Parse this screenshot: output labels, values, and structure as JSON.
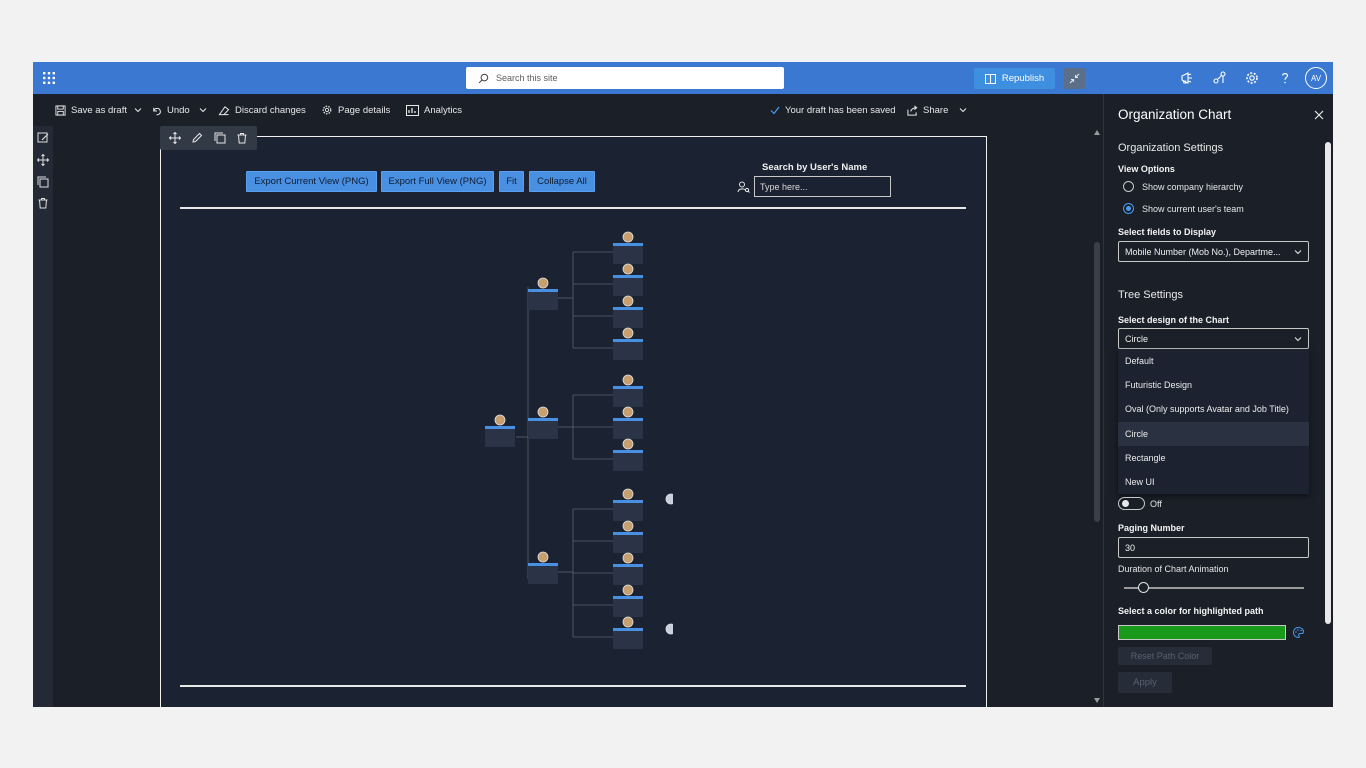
{
  "suitebar": {
    "search_placeholder": "Search this site",
    "avatar_initials": "AV",
    "color": "#3a78d2"
  },
  "command_bar": {
    "save_draft": "Save as draft",
    "undo": "Undo",
    "discard": "Discard changes",
    "page_details": "Page details",
    "analytics": "Analytics",
    "draft_status": "Your draft has been saved",
    "share": "Share",
    "republish": "Republish"
  },
  "webpart": {
    "buttons": [
      "Export Current View (PNG)",
      "Export Full View (PNG)",
      "Fit",
      "Collapse All"
    ],
    "search_label": "Search by User's Name",
    "search_placeholder": "Type here..."
  },
  "panel": {
    "title": "Organization Chart",
    "org_settings_heading": "Organization Settings",
    "view_options_label": "View Options",
    "view_options": [
      {
        "label": "Show company hierarchy",
        "selected": false
      },
      {
        "label": "Show current user's team",
        "selected": true
      }
    ],
    "fields_label": "Select fields to Display",
    "fields_value": "Mobile Number (Mob No.), Departme...",
    "tree_settings_heading": "Tree Settings",
    "design_label": "Select design of the Chart",
    "design_value": "Circle",
    "design_options": [
      "Default",
      "Futuristic Design",
      "Oval (Only supports Avatar and Job Title)",
      "Circle",
      "Rectangle",
      "New UI"
    ],
    "design_selected": "Circle",
    "toggle_state": "Off",
    "paging_label": "Paging Number",
    "paging_value": "30",
    "animation_label": "Duration of Chart Animation",
    "animation_level": 0.1,
    "color_label": "Select a color for highlighted path",
    "highlight_color": "#1a9a1a",
    "reset_color": "Reset Path Color",
    "apply": "Apply"
  }
}
